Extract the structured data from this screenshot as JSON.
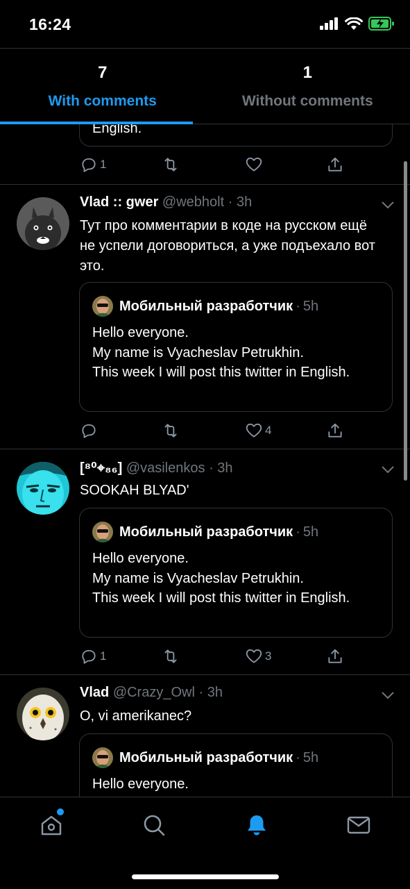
{
  "status_bar": {
    "time": "16:24"
  },
  "tabs": [
    {
      "count": "7",
      "label": "With comments",
      "active": true
    },
    {
      "count": "1",
      "label": "Without comments",
      "active": false
    }
  ],
  "partial_tweet": {
    "quote_tail": "English.",
    "reply_count": "1",
    "retweet_count": "",
    "like_count": ""
  },
  "tweets": [
    {
      "name": "Vlad :: gwer",
      "handle": "@webholt",
      "time": "3h",
      "text": "Тут про комментарии в коде на русском ещё не успели договориться, а уже подъехало вот это.",
      "quote": {
        "name": "Мобильный разработчик",
        "time": "5h",
        "text": "Hello everyone.\nMy name is Vyacheslav Petrukhin.\nThis week I will post this twitter in English."
      },
      "reply_count": "",
      "retweet_count": "",
      "like_count": "4"
    },
    {
      "name": "[⁸⁰⌖₈₆]",
      "handle": "@vasilenkos",
      "time": "3h",
      "text": "SOOKAH BLYAD'",
      "quote": {
        "name": "Мобильный разработчик",
        "time": "5h",
        "text": "Hello everyone.\nMy name is Vyacheslav Petrukhin.\nThis week I will post this twitter in English."
      },
      "reply_count": "1",
      "retweet_count": "",
      "like_count": "3"
    },
    {
      "name": "Vlad",
      "handle": "@Crazy_Owl",
      "time": "3h",
      "text": "O, vi amerikanec?",
      "quote": {
        "name": "Мобильный разработчик",
        "time": "5h",
        "text": "Hello everyone."
      }
    }
  ],
  "separator": "·",
  "bottom_nav": {
    "items": [
      "home-icon",
      "search-icon",
      "notifications-bell-icon",
      "messages-envelope-icon"
    ],
    "active": "notifications-bell-icon",
    "accent": "#1d9bf0"
  },
  "colors": {
    "accent": "#1d9bf0",
    "muted": "#71767b",
    "background": "#000000",
    "border": "#2f3336"
  }
}
